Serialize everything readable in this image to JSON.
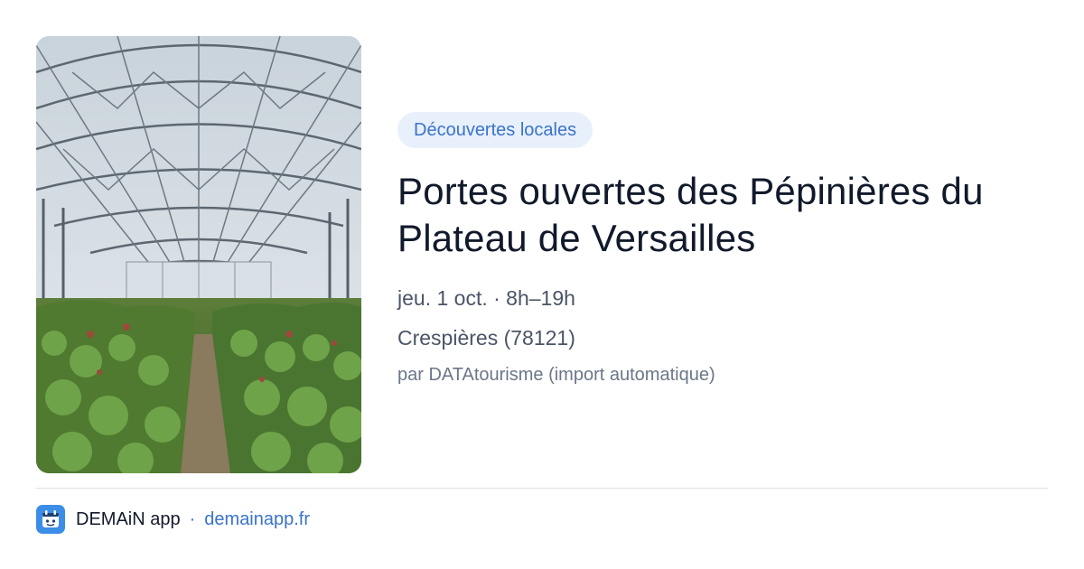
{
  "event": {
    "category": "Découvertes locales",
    "title": "Portes ouvertes des Pépinières du Plateau de Versailles",
    "date": "jeu. 1 oct. · 8h–19h",
    "location": "Crespières (78121)",
    "source": "par DATAtourisme (import automatique)",
    "image_icon": "greenhouse-photo"
  },
  "footer": {
    "app_name": "DEMAiN app",
    "separator": "·",
    "site": "demainapp.fr",
    "logo_icon": "demain-logo-icon"
  },
  "colors": {
    "accent": "#3a73c9",
    "tag_bg": "#e8f0fc",
    "title": "#111a2b",
    "muted": "#4a5567"
  }
}
